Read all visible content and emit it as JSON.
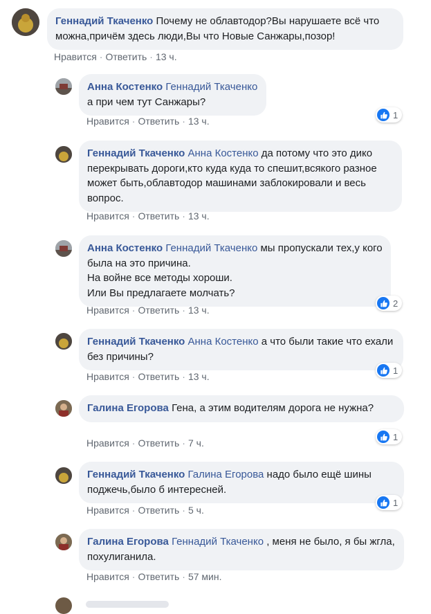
{
  "actions": {
    "like": "Нравится",
    "reply": "Ответить",
    "dot": "·"
  },
  "comments": [
    {
      "author": "Геннадий Ткаченко",
      "mention": "",
      "text": "Почему не облавтодор?Вы нарушаете всё что можна,причём здесь люди,Вы что Новые Санжары,позор!",
      "time": "13 ч.",
      "reactions": ""
    },
    {
      "author": "Анна Костенко",
      "mention": "Геннадий Ткаченко",
      "text": "а при чем тут Санжары?",
      "time": "13 ч.",
      "reactions": "1"
    },
    {
      "author": "Геннадий Ткаченко",
      "mention": "Анна Костенко",
      "text": "да потому что это дико перекрывать дороги,кто куда куда то спешит,всякого разное может быть,облавтодор машинами заблокировали и весь вопрос.",
      "time": "13 ч.",
      "reactions": ""
    },
    {
      "author": "Анна Костенко",
      "mention": "Геннадий Ткаченко",
      "text": "мы пропускали тех,у кого была на это причина.\nНа войне все методы хороши.\nИли Вы предлагаете молчать?",
      "time": "13 ч.",
      "reactions": "2"
    },
    {
      "author": "Геннадий Ткаченко",
      "mention": "Анна Костенко",
      "text": "а что были такие что ехали без причины?",
      "time": "13 ч.",
      "reactions": "1"
    },
    {
      "author": "Галина Егорова",
      "mention": "",
      "text": "Гена, а этим водителям дорога не нужна?",
      "time": "7 ч.",
      "reactions": "1"
    },
    {
      "author": "Геннадий Ткаченко",
      "mention": "Галина Егорова",
      "text": "надо было ещё шины поджечь,было б интересней.",
      "time": "5 ч.",
      "reactions": "1"
    },
    {
      "author": "Галина Егорова",
      "mention": "Геннадий Ткаченко",
      "text": ", меня не было, я бы жгла, похулиганила.",
      "time": "57 мин.",
      "reactions": ""
    }
  ],
  "colors": {
    "link": "#385898",
    "bubble": "#f0f2f5",
    "like": "#1877f2"
  }
}
